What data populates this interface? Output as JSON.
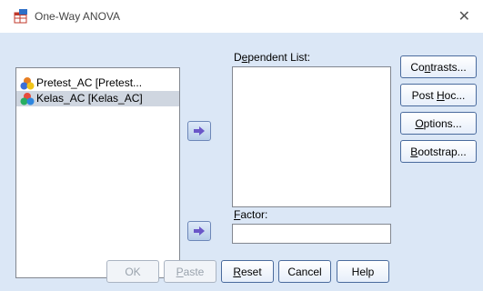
{
  "window": {
    "title": "One-Way ANOVA",
    "close_glyph": "✕",
    "app_icon": "spss-table-icon"
  },
  "variables": [
    {
      "label": "Pretest_AC [Pretest...",
      "icon": "scale-variable-icon",
      "selected": false
    },
    {
      "label": "Kelas_AC [Kelas_AC]",
      "icon": "nominal-variable-icon",
      "selected": true
    }
  ],
  "dependent_list": {
    "label_pre": "D",
    "label_u": "e",
    "label_post": "pendent List:"
  },
  "factor": {
    "label_u": "F",
    "label_post": "actor:",
    "value": ""
  },
  "side_buttons": {
    "contrasts": {
      "pre": "Co",
      "u": "n",
      "post": "trasts..."
    },
    "post_hoc": {
      "pre": "Post ",
      "u": "H",
      "post": "oc..."
    },
    "options": {
      "pre": "",
      "u": "O",
      "post": "ptions..."
    },
    "bootstrap": {
      "pre": "",
      "u": "B",
      "post": "ootstrap..."
    }
  },
  "bottom_buttons": {
    "ok": "OK",
    "paste": {
      "u": "P",
      "post": "aste"
    },
    "reset": {
      "u": "R",
      "post": "eset"
    },
    "cancel": "Cancel",
    "help": "Help"
  },
  "colors": {
    "client_bg": "#dbe7f6",
    "arrow": "#6a56c8"
  }
}
